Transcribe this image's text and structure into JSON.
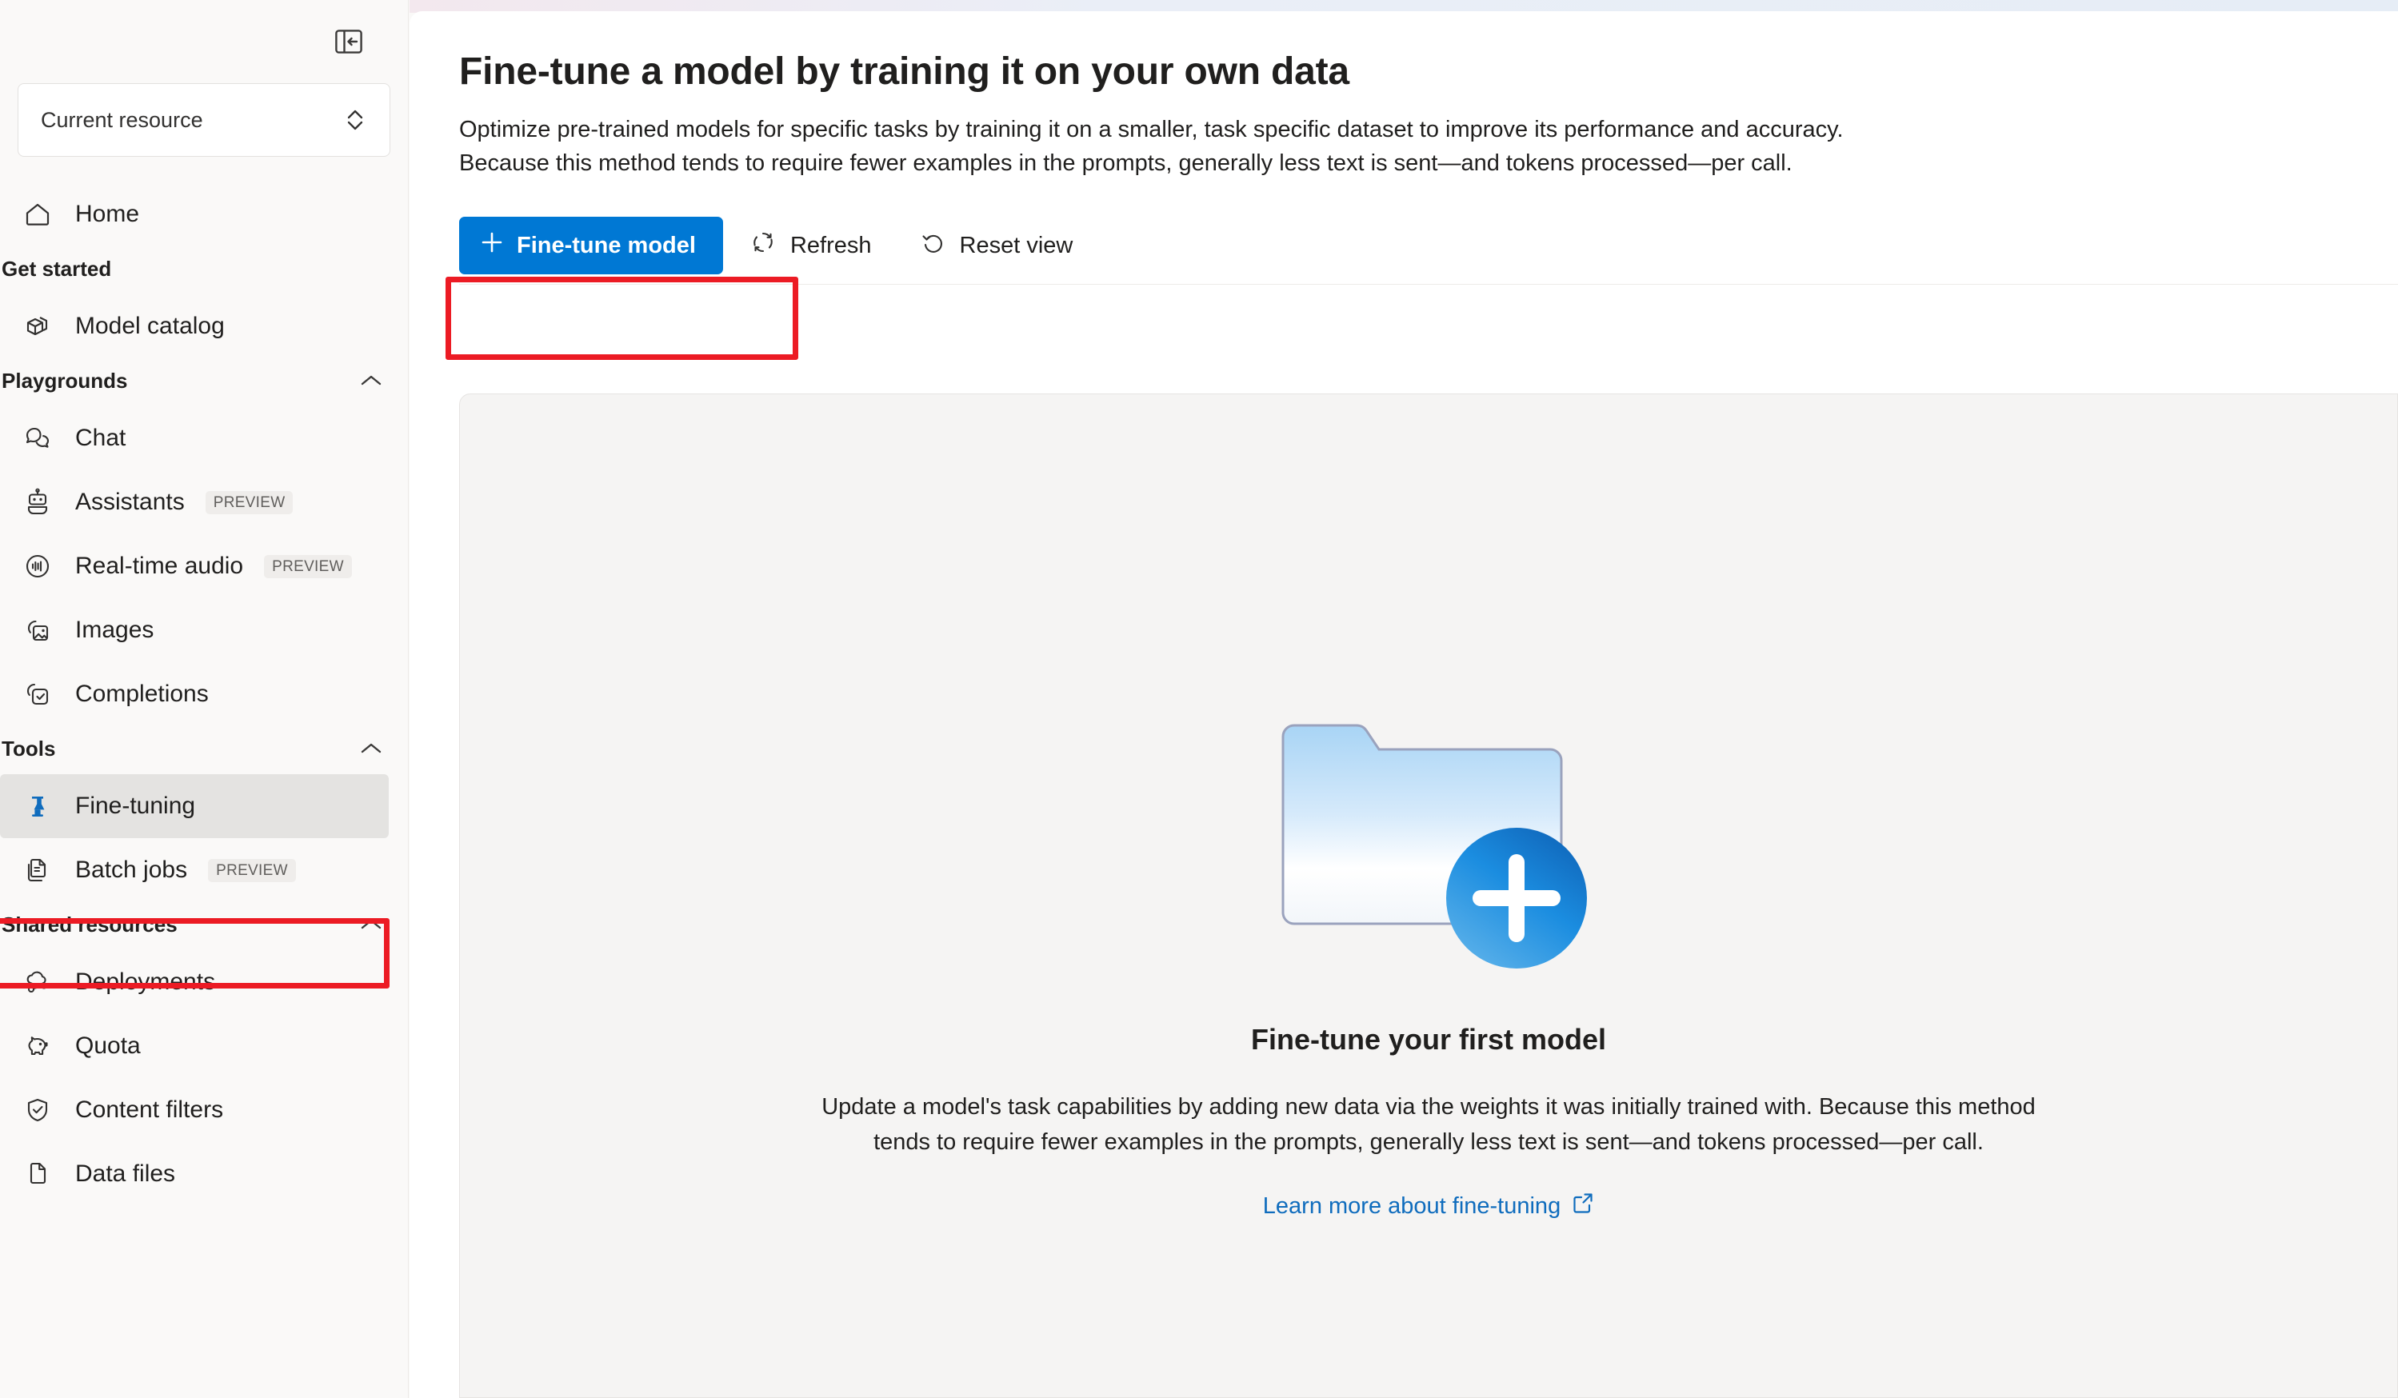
{
  "sidebar": {
    "collapse_icon": "panel-collapse-icon",
    "resource_picker": {
      "label": "Current resource",
      "chevron_icon": "up-down-chevron-icon"
    },
    "top_items": [
      {
        "label": "Home",
        "icon": "home-icon",
        "name": "home"
      }
    ],
    "sections": [
      {
        "title": "Get started",
        "name": "get-started",
        "collapsible": false,
        "items": [
          {
            "label": "Model catalog",
            "icon": "cube-icon",
            "name": "model-catalog",
            "badge": ""
          }
        ]
      },
      {
        "title": "Playgrounds",
        "name": "playgrounds",
        "collapsible": true,
        "chevron_icon": "chevron-up-icon",
        "items": [
          {
            "label": "Chat",
            "icon": "chat-bubbles-icon",
            "name": "chat",
            "badge": ""
          },
          {
            "label": "Assistants",
            "icon": "robot-icon",
            "name": "assistants",
            "badge": "PREVIEW"
          },
          {
            "label": "Real-time audio",
            "icon": "audio-waveform-icon",
            "name": "real-time-audio",
            "badge": "PREVIEW"
          },
          {
            "label": "Images",
            "icon": "image-icon",
            "name": "images",
            "badge": ""
          },
          {
            "label": "Completions",
            "icon": "completions-icon",
            "name": "completions",
            "badge": ""
          }
        ]
      },
      {
        "title": "Tools",
        "name": "tools",
        "collapsible": true,
        "chevron_icon": "chevron-up-icon",
        "items": [
          {
            "label": "Fine-tuning",
            "icon": "fine-tuning-icon",
            "name": "fine-tuning",
            "badge": "",
            "selected": true
          },
          {
            "label": "Batch jobs",
            "icon": "batch-jobs-icon",
            "name": "batch-jobs",
            "badge": "PREVIEW"
          }
        ]
      },
      {
        "title": "Shared resources",
        "name": "shared-resources",
        "collapsible": true,
        "chevron_icon": "chevron-up-icon",
        "items": [
          {
            "label": "Deployments",
            "icon": "cloud-deploy-icon",
            "name": "deployments",
            "badge": ""
          },
          {
            "label": "Quota",
            "icon": "piggy-bank-icon",
            "name": "quota",
            "badge": ""
          },
          {
            "label": "Content filters",
            "icon": "shield-check-icon",
            "name": "content-filters",
            "badge": ""
          },
          {
            "label": "Data files",
            "icon": "document-icon",
            "name": "data-files",
            "badge": ""
          }
        ]
      }
    ]
  },
  "main": {
    "title": "Fine-tune a model by training it on your own data",
    "description": "Optimize pre-trained models for specific tasks by training it on a smaller, task specific dataset to improve its performance and accuracy. Because this method tends to require fewer examples in the prompts, generally less text is sent—and tokens processed—per call.",
    "toolbar": {
      "primary_label": "Fine-tune model",
      "primary_icon": "plus-icon",
      "refresh_label": "Refresh",
      "refresh_icon": "refresh-icon",
      "reset_label": "Reset view",
      "reset_icon": "reset-icon"
    },
    "empty_state": {
      "illustration": "folder-with-plus-illustration",
      "title": "Fine-tune your first model",
      "text": "Update a model's task capabilities by adding new data via the weights it was initially trained with. Because this method tends to require fewer examples in the prompts, generally less text is sent—and tokens processed—per call.",
      "link_label": "Learn more about fine-tuning",
      "link_icon": "external-link-icon"
    }
  },
  "colors": {
    "accent": "#0078d4",
    "link": "#0f6cbd",
    "annotation": "#ec1b24",
    "selected_bg": "#e4e3e1",
    "sidebar_bg": "#faf9f8",
    "card_bg": "#f5f4f3"
  }
}
